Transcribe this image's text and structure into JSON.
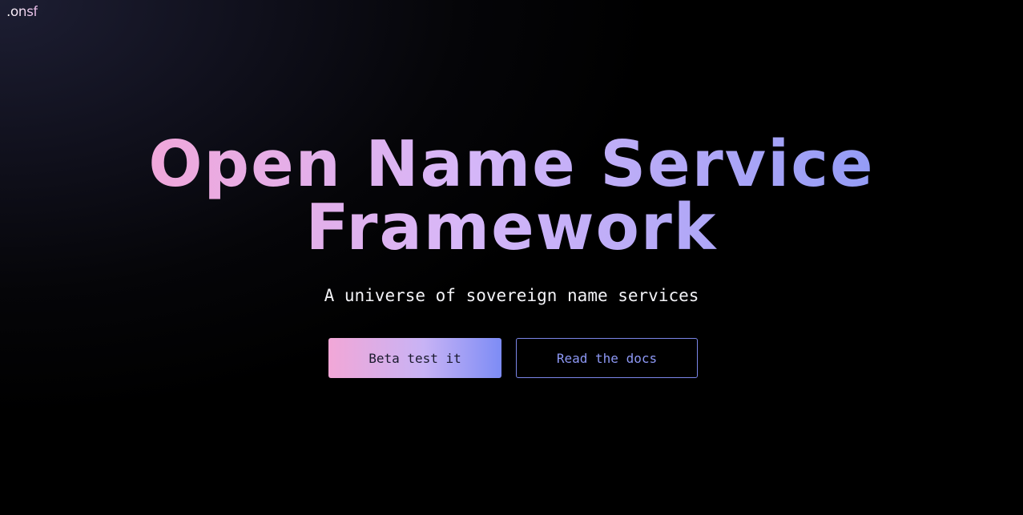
{
  "header": {
    "logo_text": ".onsf"
  },
  "hero": {
    "title_line1": "Open Name Service",
    "title_line2": "Framework",
    "subtitle": "A universe of sovereign name services"
  },
  "actions": {
    "primary_label": "Beta test it",
    "secondary_label": "Read the docs"
  },
  "colors": {
    "background": "#000000",
    "gradient_pink": "#f2a6d8",
    "gradient_lavender": "#d7b7f8",
    "gradient_blue": "#8c99f6",
    "secondary_border": "#7b86e8"
  }
}
